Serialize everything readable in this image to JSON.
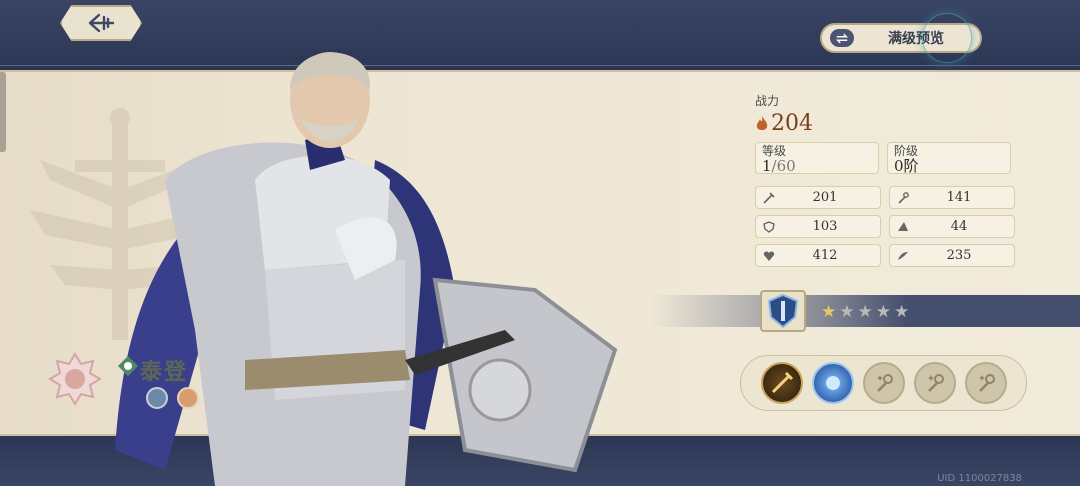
{
  "header": {
    "back_icon": "back-arrow-icon",
    "preview_label": "满级预览",
    "preview_icon": "swap-arrows-icon"
  },
  "hero": {
    "name": "泰登",
    "class_icon": "class-emblem-icon",
    "element_icon": "element-diamond-icon"
  },
  "stats": {
    "power_label": "战力",
    "power_value": "204",
    "level_label": "等级",
    "level_current": "1",
    "level_max": "/60",
    "rank_label": "阶级",
    "rank_value": "0阶",
    "attributes": [
      {
        "icon": "sword-icon",
        "value": "201"
      },
      {
        "icon": "staff-icon",
        "value": "141"
      },
      {
        "icon": "shield-icon",
        "value": "103"
      },
      {
        "icon": "hat-icon",
        "value": "44"
      },
      {
        "icon": "heart-icon",
        "value": "412"
      },
      {
        "icon": "wing-icon",
        "value": "235"
      }
    ]
  },
  "stars": {
    "total": 5,
    "filled": 1
  },
  "skills": [
    {
      "icon": "sword-skill-icon",
      "unlocked": true
    },
    {
      "icon": "blue-orb-skill-icon",
      "unlocked": true
    },
    {
      "icon": "locked-staff-skill-icon",
      "unlocked": false
    },
    {
      "icon": "locked-staff-skill-icon",
      "unlocked": false
    },
    {
      "icon": "locked-staff-skill-icon",
      "unlocked": false
    }
  ],
  "footer": {
    "uid": "UID 1100027838"
  },
  "colors": {
    "accent_power": "#7a3f1c",
    "panel": "#efe7d5",
    "navy": "#2f3a57",
    "star_gold": "#e8c766",
    "star_gray": "#b9b9b9"
  }
}
